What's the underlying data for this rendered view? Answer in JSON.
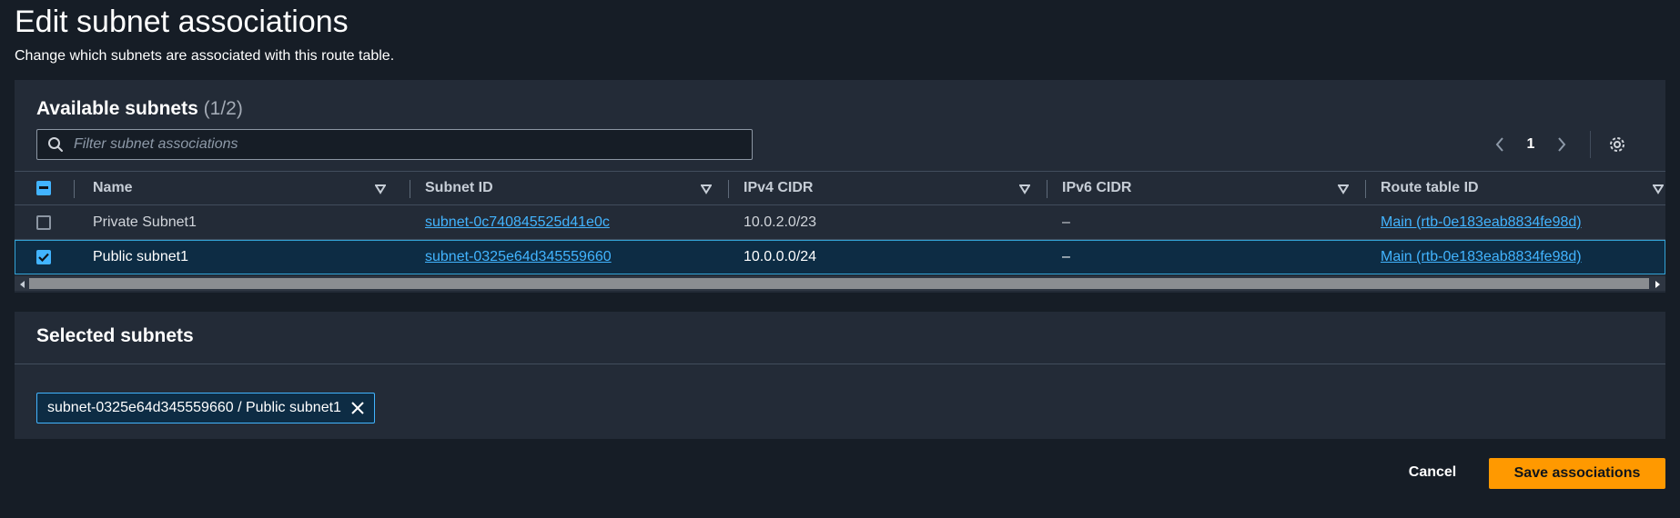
{
  "page": {
    "title": "Edit subnet associations",
    "description": "Change which subnets are associated with this route table."
  },
  "available": {
    "title": "Available subnets",
    "count": "(1/2)",
    "filter_placeholder": "Filter subnet associations",
    "page_number": "1",
    "columns": [
      "Name",
      "Subnet ID",
      "IPv4 CIDR",
      "IPv6 CIDR",
      "Route table ID"
    ],
    "rows": [
      {
        "name": "Private Subnet1",
        "subnet_id": "subnet-0c740845525d41e0c",
        "ipv4": "10.0.2.0/23",
        "ipv6": "–",
        "route_table": "Main (rtb-0e183eab8834fe98d)",
        "selected": false
      },
      {
        "name": "Public subnet1",
        "subnet_id": "subnet-0325e64d345559660",
        "ipv4": "10.0.0.0/24",
        "ipv6": "–",
        "route_table": "Main (rtb-0e183eab8834fe98d)",
        "selected": true
      }
    ]
  },
  "selected": {
    "title": "Selected subnets",
    "token_label": "subnet-0325e64d345559660 / Public subnet1"
  },
  "footer": {
    "cancel_label": "Cancel",
    "save_label": "Save associations"
  },
  "icons": {
    "search": "search-icon",
    "prev": "chevron-left-icon",
    "next": "chevron-right-icon",
    "settings": "gear-icon",
    "sort": "sort-caret-icon",
    "remove": "close-icon"
  },
  "colors": {
    "background": "#161d26",
    "panel": "#232b37",
    "link": "#42b4ff",
    "primary_button": "#ff9900",
    "selected_row": "#0d2c44"
  }
}
